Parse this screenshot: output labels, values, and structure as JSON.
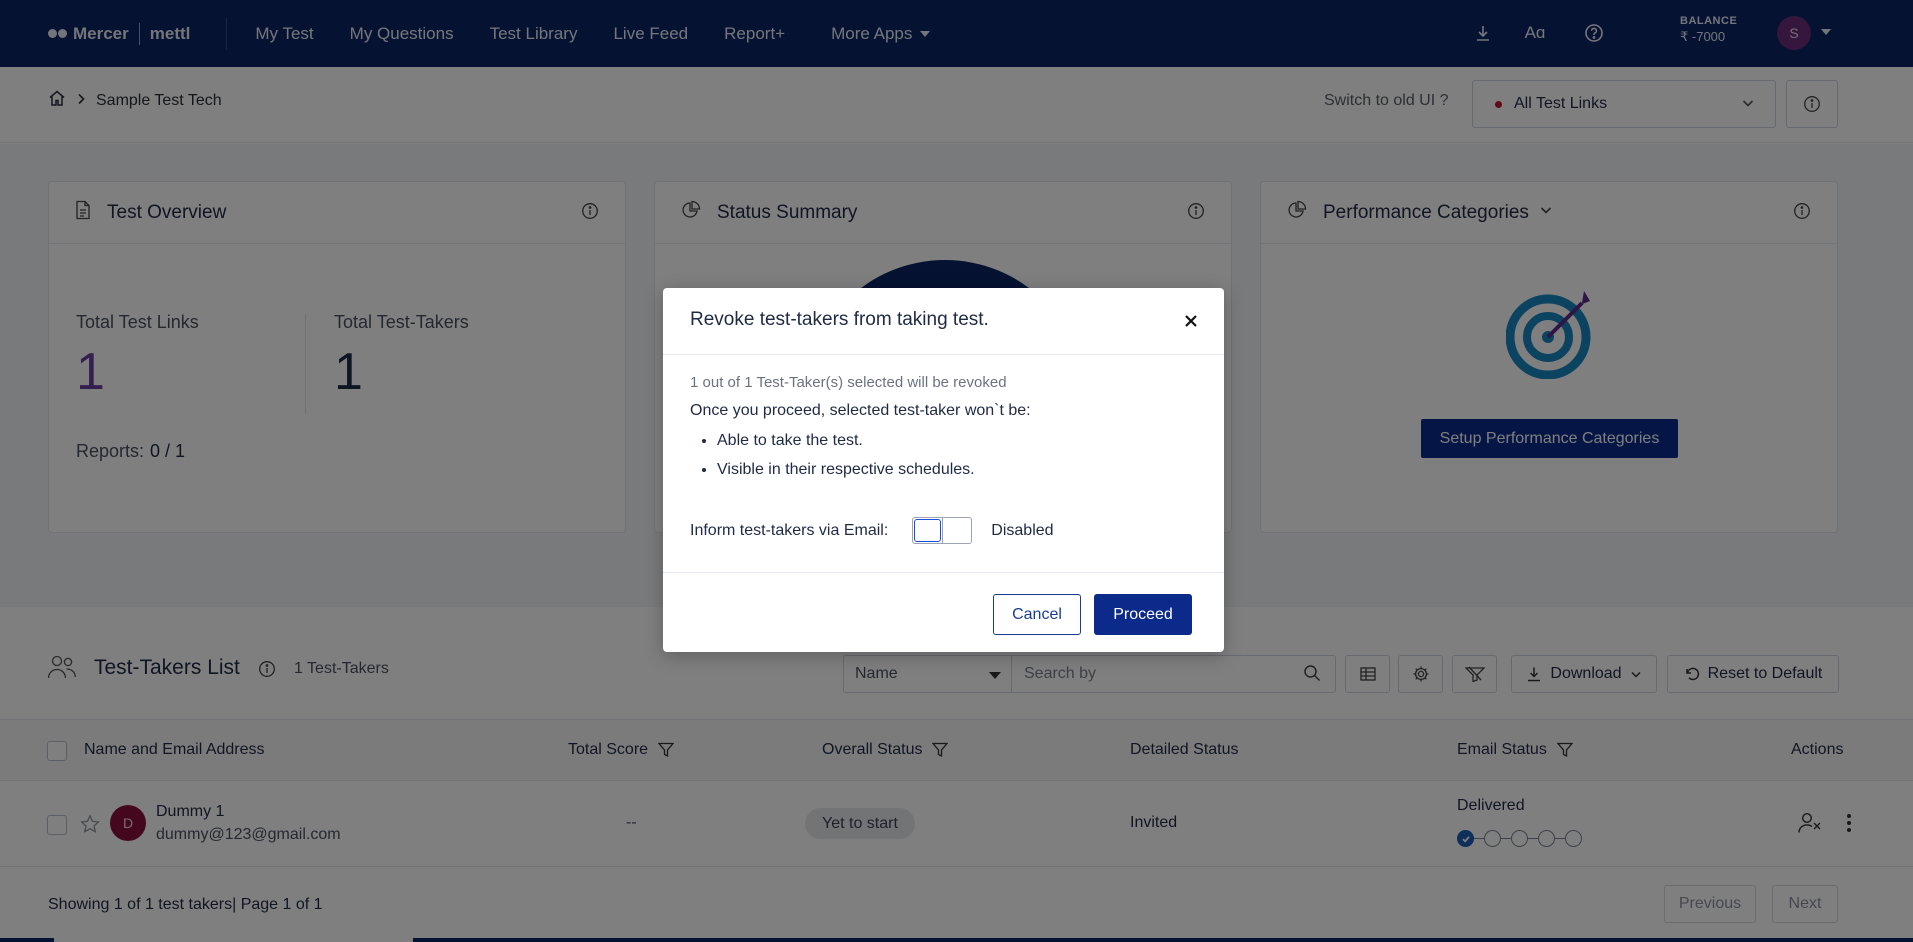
{
  "nav": {
    "brand_name": "Mercer",
    "brand_sub": "mettl",
    "links": [
      "My Test",
      "My Questions",
      "Test Library",
      "Live Feed",
      "Report+",
      "More Apps"
    ],
    "balance_label": "BALANCE",
    "balance_value": "₹ -7000",
    "avatar_initial": "S",
    "icons": [
      "download-icon",
      "font-size-icon",
      "help-icon"
    ]
  },
  "subheader": {
    "breadcrumb_current": "Sample Test Tech",
    "switch_ui": "Switch to old UI ?",
    "links_select": "All Test Links"
  },
  "overview": {
    "title": "Test Overview",
    "total_links_label": "Total Test Links",
    "total_links_value": "1",
    "total_takers_label": "Total Test-Takers",
    "total_takers_value": "1",
    "reports_label": "Reports:",
    "reports_value": "0 / 1"
  },
  "status_summary": {
    "title": "Status Summary"
  },
  "performance": {
    "title": "Performance Categories",
    "setup_button": "Setup Performance Categories"
  },
  "list": {
    "title": "Test-Takers List",
    "count": "1 Test-Takers",
    "search_field": "Name",
    "search_placeholder": "Search by",
    "download": "Download",
    "reset": "Reset to Default",
    "columns": [
      "Name and Email Address",
      "Total Score",
      "Overall Status",
      "Detailed Status",
      "Email Status",
      "Actions"
    ],
    "rows": [
      {
        "initial": "D",
        "name": "Dummy 1",
        "email": "dummy@123@gmail.com",
        "score": "--",
        "overall_status": "Yet to start",
        "detailed_status": "Invited",
        "email_status": "Delivered",
        "email_steps_done": 1,
        "email_steps_total": 5
      }
    ],
    "showing": "Showing 1 of 1 test takers| Page 1 of 1",
    "previous": "Previous",
    "next": "Next"
  },
  "modal": {
    "title": "Revoke test-takers from taking test.",
    "count_text": "1 out of 1 Test-Taker(s) selected will be revoked",
    "intro": "Once you proceed, selected test-taker won`t be:",
    "bullets": [
      "Able to take the test.",
      "Visible in their respective schedules."
    ],
    "email_label": "Inform test-takers via Email:",
    "toggle_state": "Disabled",
    "cancel": "Cancel",
    "proceed": "Proceed"
  },
  "colors": {
    "nav_bg": "#0a2463",
    "primary_button": "#0b2a8a",
    "overview_number": "#6b3fa0",
    "avatar_user": "#6b2d7b",
    "avatar_row": "#8a0f3d",
    "target_blue": "#1787c1",
    "target_purple": "#5b2b8c"
  }
}
